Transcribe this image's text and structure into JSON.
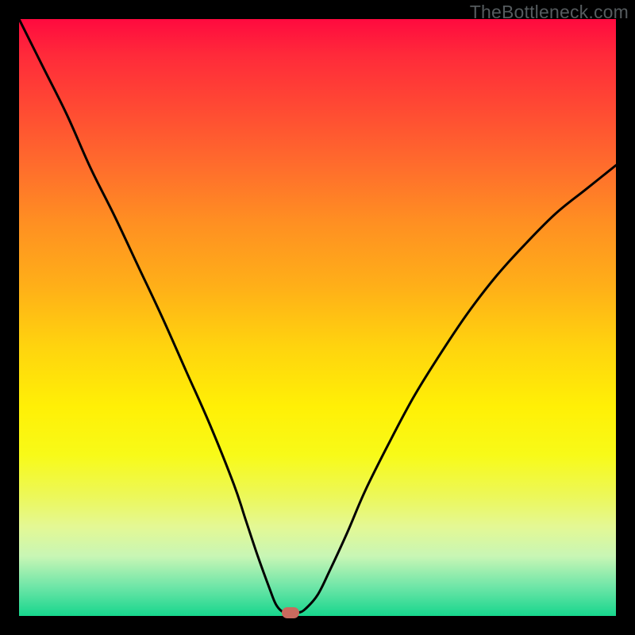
{
  "watermark": "TheBottleneck.com",
  "colors": {
    "frame": "#000000",
    "curve": "#000000",
    "marker": "#c96a5e"
  },
  "chart_data": {
    "type": "line",
    "title": "",
    "xlabel": "",
    "ylabel": "",
    "xlim": [
      0,
      100
    ],
    "ylim": [
      0,
      100
    ],
    "grid": false,
    "legend": false,
    "x": [
      0,
      4,
      8,
      12,
      16,
      20,
      24,
      28,
      32,
      36,
      38,
      40,
      42,
      43,
      44,
      45,
      46,
      47,
      48,
      50,
      52,
      55,
      58,
      62,
      66,
      70,
      75,
      80,
      85,
      90,
      95,
      100
    ],
    "values": [
      100,
      92,
      84,
      75,
      67,
      58.5,
      50,
      41,
      32,
      22,
      16,
      10,
      4.5,
      2,
      0.8,
      0.5,
      0.5,
      0.6,
      1.2,
      3.5,
      7.5,
      14,
      21,
      29,
      36.5,
      43,
      50.5,
      57,
      62.5,
      67.5,
      71.5,
      75.5
    ],
    "marker": {
      "x": 45.5,
      "y": 0.5
    },
    "annotations": []
  }
}
